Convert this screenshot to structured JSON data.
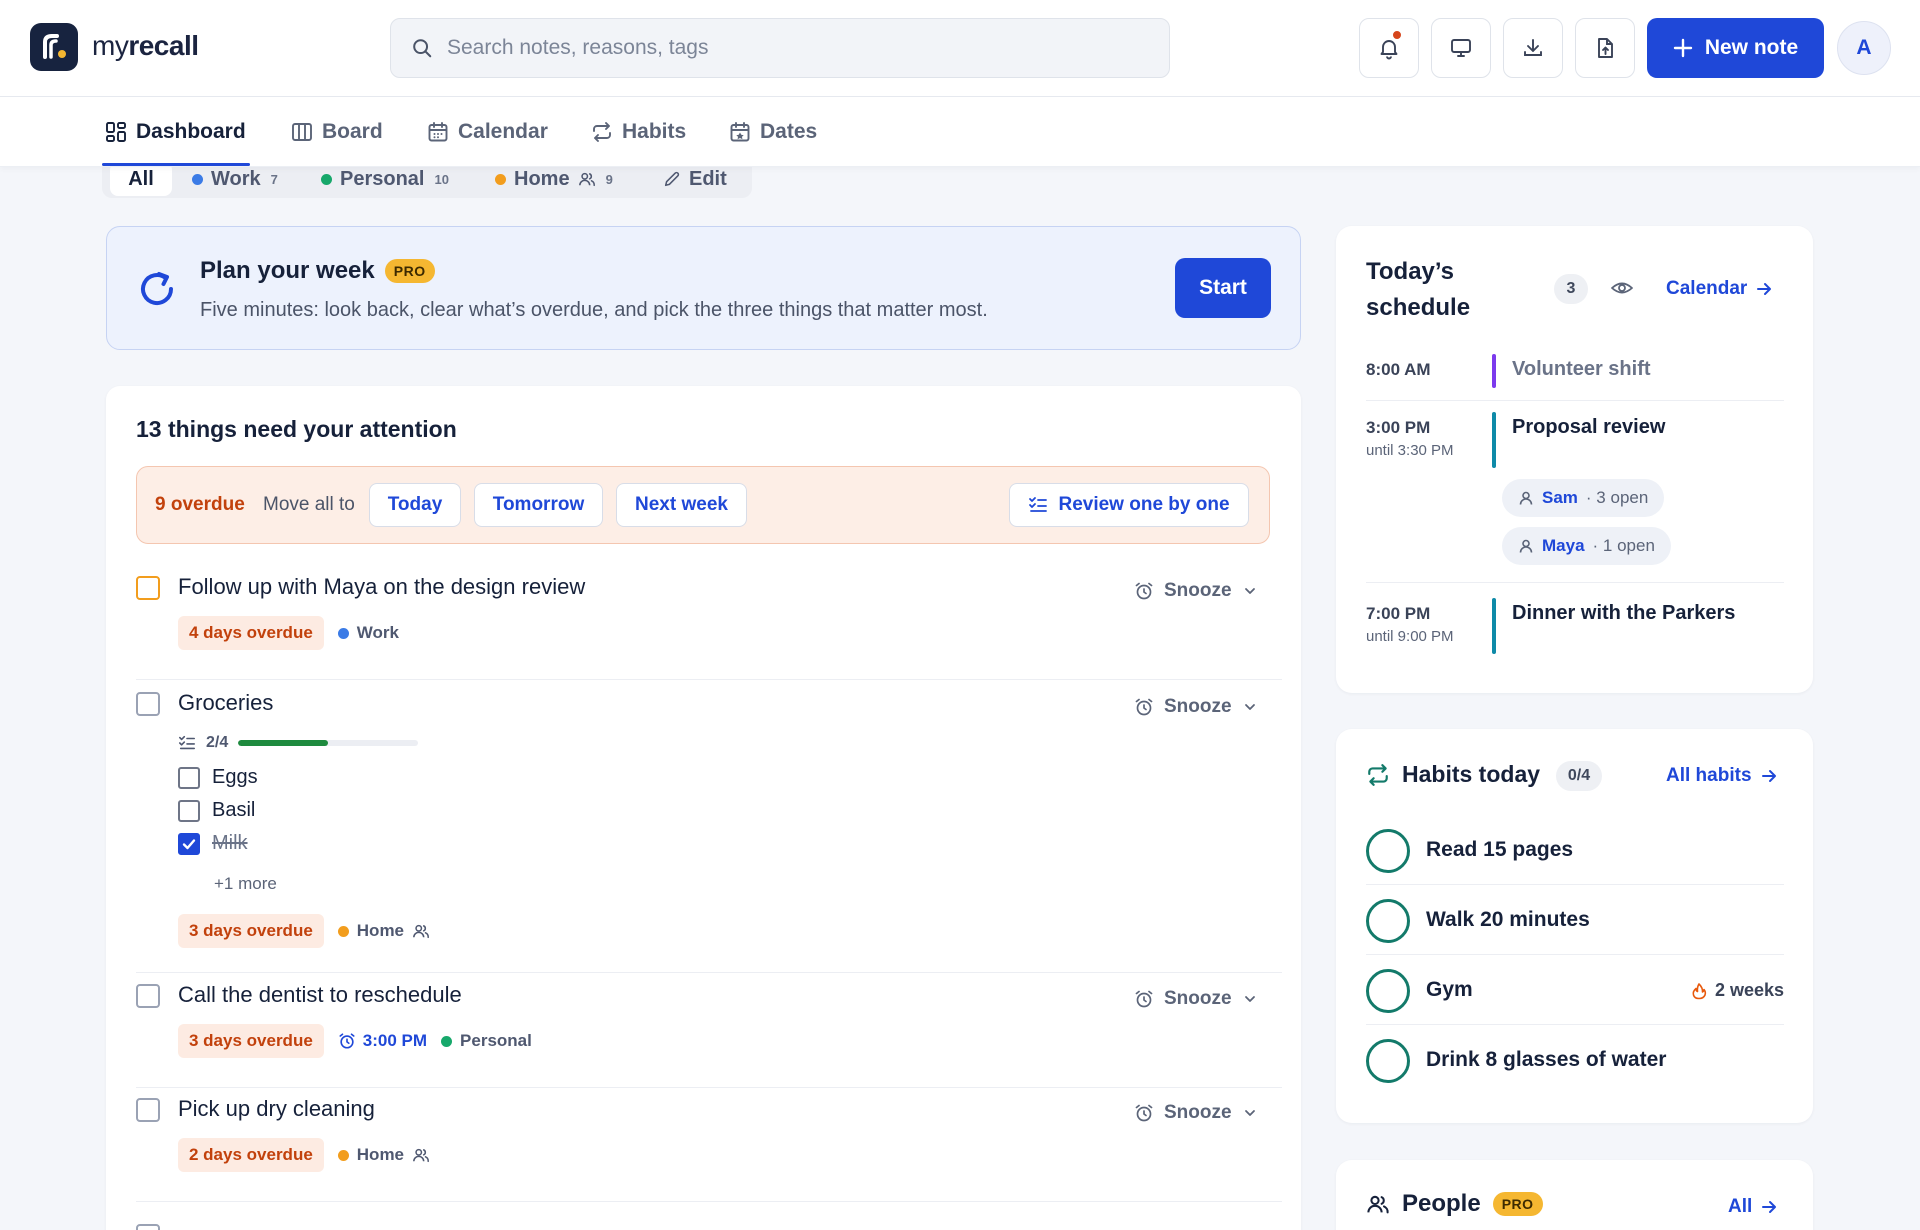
{
  "app": {
    "name_prefix": "my",
    "name_bold": "recall"
  },
  "search": {
    "placeholder": "Search notes, reasons, tags"
  },
  "toolbar": {
    "new_note_label": "New note",
    "avatar_initial": "A"
  },
  "colors": {
    "accent": "#1f48d8",
    "overdue": "#c2410c",
    "work": "#3b7be6",
    "personal": "#17a86b",
    "home": "#f29d1d",
    "habit_ring": "#137a6a",
    "event_purple": "#7c3aed",
    "event_teal": "#0e8aa8"
  },
  "nav": {
    "tabs": [
      {
        "label": "Dashboard",
        "icon": "dashboard-icon",
        "active": true
      },
      {
        "label": "Board",
        "icon": "board-icon"
      },
      {
        "label": "Calendar",
        "icon": "calendar-icon"
      },
      {
        "label": "Habits",
        "icon": "repeat-icon"
      },
      {
        "label": "Dates",
        "icon": "dates-icon"
      }
    ]
  },
  "filters": {
    "all": "All",
    "work": {
      "label": "Work",
      "count": "7"
    },
    "personal": {
      "label": "Personal",
      "count": "10"
    },
    "home": {
      "label": "Home",
      "count": "9"
    },
    "edit": "Edit"
  },
  "plan": {
    "title": "Plan your week",
    "badge": "PRO",
    "subtitle": "Five minutes: look back, clear what’s overdue, and pick the three things that matter most.",
    "start_label": "Start"
  },
  "attention": {
    "title": "13 things need your attention",
    "overdue_count": "9 overdue",
    "move_all_label": "Move all to",
    "move_options": [
      "Today",
      "Tomorrow",
      "Next week"
    ],
    "review_label": "Review one by one",
    "snooze_label": "Snooze",
    "tasks": [
      {
        "title": "Follow up with Maya on the design review",
        "overdue": "4 days overdue",
        "tag": "Work"
      },
      {
        "title": "Groceries",
        "progress": "2/4",
        "progress_value": 0.5,
        "subitems": [
          {
            "label": "Eggs",
            "done": false
          },
          {
            "label": "Basil",
            "done": false
          },
          {
            "label": "Milk",
            "done": true
          }
        ],
        "more": "+1 more",
        "overdue": "3 days overdue",
        "tag": "Home"
      },
      {
        "title": "Call the dentist to reschedule",
        "overdue": "3 days overdue",
        "time": "3:00 PM",
        "tag": "Personal"
      },
      {
        "title": "Pick up dry cleaning",
        "overdue": "2 days overdue",
        "tag": "Home"
      }
    ]
  },
  "schedule": {
    "title_line1": "Today’s",
    "title_line2": "schedule",
    "count": "3",
    "calendar_link": "Calendar",
    "events": [
      {
        "time": "8:00 AM",
        "title": "Volunteer shift"
      },
      {
        "time": "3:00 PM",
        "until": "until 3:30 PM",
        "title": "Proposal review",
        "people": [
          {
            "name": "Sam",
            "open": "· 3 open"
          },
          {
            "name": "Maya",
            "open": "· 1 open"
          }
        ]
      },
      {
        "time": "7:00 PM",
        "until": "until 9:00 PM",
        "title": "Dinner with the Parkers"
      }
    ]
  },
  "habits": {
    "title": "Habits today",
    "count": "0/4",
    "link": "All habits",
    "items": [
      {
        "label": "Read 15 pages"
      },
      {
        "label": "Walk 20 minutes"
      },
      {
        "label": "Gym",
        "streak": "2 weeks"
      },
      {
        "label": "Drink 8 glasses of water"
      }
    ]
  },
  "people": {
    "title": "People",
    "badge": "PRO",
    "link": "All"
  }
}
